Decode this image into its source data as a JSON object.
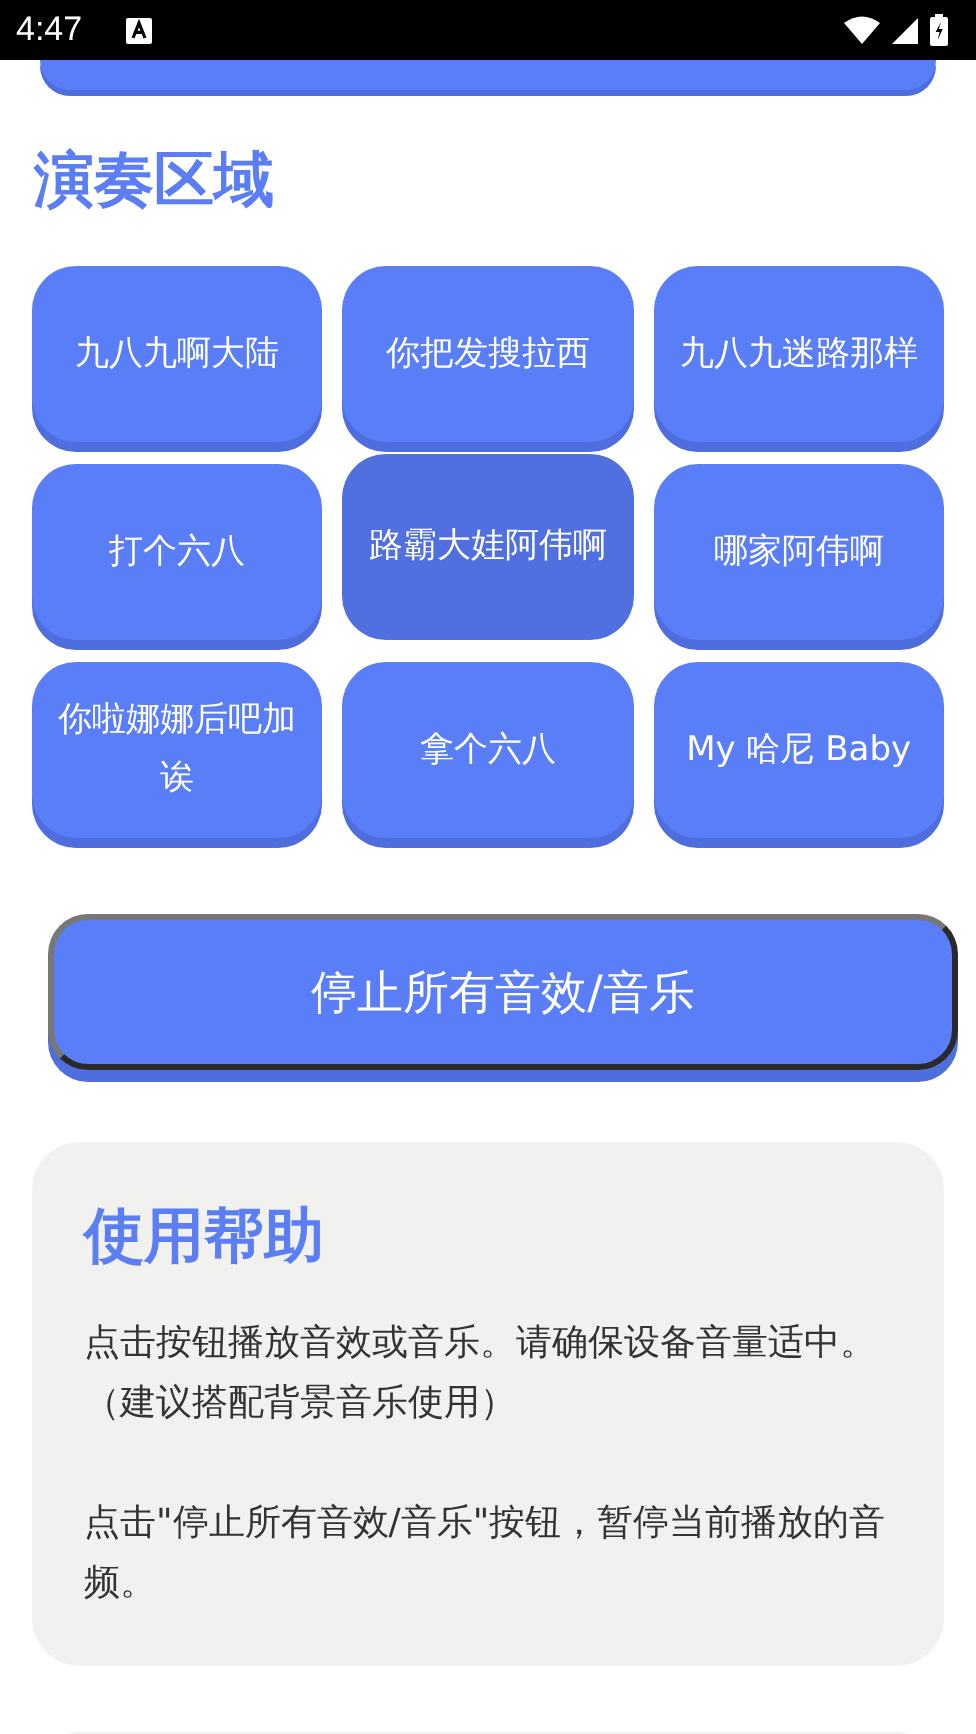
{
  "status_bar": {
    "time": "4:47"
  },
  "section_title": "演奏区域",
  "sound_buttons": [
    {
      "label": "九八九啊大陆",
      "selected": false
    },
    {
      "label": "你把发搜拉西",
      "selected": false
    },
    {
      "label": "九八九迷路那样",
      "selected": false
    },
    {
      "label": "打个六八",
      "selected": false
    },
    {
      "label": "路霸大娃阿伟啊",
      "selected": true
    },
    {
      "label": "哪家阿伟啊",
      "selected": false
    },
    {
      "label": "你啦娜娜后吧加诶",
      "selected": false
    },
    {
      "label": "拿个六八",
      "selected": false
    },
    {
      "label": "My 哈尼 Baby",
      "selected": false
    }
  ],
  "stop_button": "停止所有音效/音乐",
  "help": {
    "title": "使用帮助",
    "paragraphs": [
      "点击按钮播放音效或音乐。请确保设备音量适中。（建议搭配背景音乐使用）",
      "点击\"停止所有音效/音乐\"按钮，暂停当前播放的音频。"
    ]
  }
}
